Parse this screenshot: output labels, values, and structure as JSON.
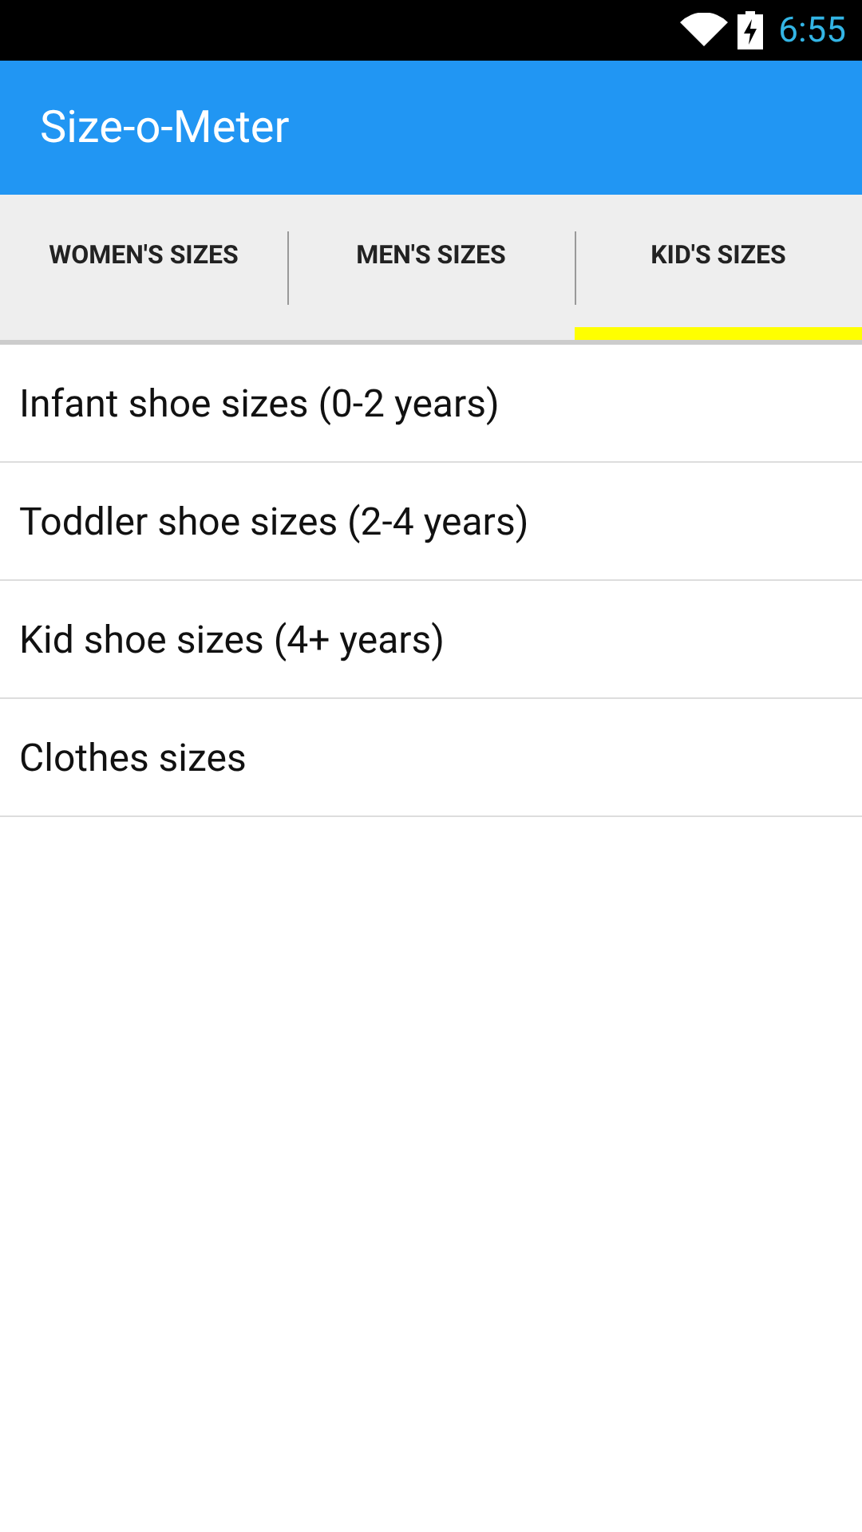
{
  "status_bar": {
    "time": "6:55",
    "charging": true
  },
  "app_bar": {
    "title": "Size-o-Meter"
  },
  "tabs": [
    {
      "label": "WOMEN'S SIZES",
      "selected": false
    },
    {
      "label": "MEN'S SIZES",
      "selected": false
    },
    {
      "label": "KID'S SIZES",
      "selected": true
    }
  ],
  "list": {
    "items": [
      "Infant shoe sizes (0-2 years)",
      "Toddler shoe sizes (2-4 years)",
      "Kid shoe sizes (4+ years)",
      "Clothes sizes"
    ]
  }
}
